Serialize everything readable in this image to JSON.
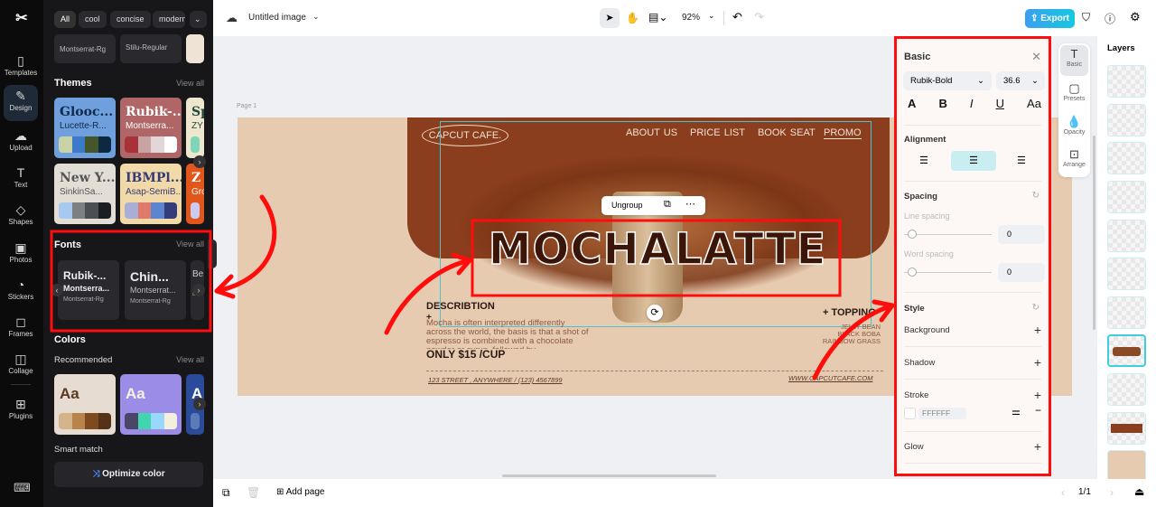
{
  "rail": {
    "items": [
      {
        "label": "Templates",
        "icon": "templates-icon"
      },
      {
        "label": "Design",
        "icon": "design-icon",
        "active": true
      },
      {
        "label": "Upload",
        "icon": "upload-icon"
      },
      {
        "label": "Text",
        "icon": "text-icon"
      },
      {
        "label": "Shapes",
        "icon": "shapes-icon"
      },
      {
        "label": "Photos",
        "icon": "photos-icon"
      },
      {
        "label": "Stickers",
        "icon": "stickers-icon"
      },
      {
        "label": "Frames",
        "icon": "frames-icon"
      },
      {
        "label": "Collage",
        "icon": "collage-icon"
      },
      {
        "label": "Plugins",
        "icon": "plugins-icon"
      }
    ]
  },
  "panel": {
    "chips": [
      "All",
      "cool",
      "concise",
      "modern"
    ],
    "top_cards": [
      {
        "sub": "Montserrat-Rg"
      },
      {
        "sub": "Stilu-Regular"
      }
    ],
    "themes": {
      "title": "Themes",
      "view_all": "View all",
      "cards": [
        {
          "t1": "Glooc...",
          "t2": "Lucette-R...",
          "bg": "#6f9fdc",
          "fg": "#0f2a4a",
          "sw": [
            "#c9d3a8",
            "#3b7bc9",
            "#45572a",
            "#0d2940"
          ]
        },
        {
          "t1": "Rubik-...",
          "t2": "Montserra...",
          "bg": "#b06666",
          "fg": "#fff",
          "sw": [
            "#a8323a",
            "#c9a3a3",
            "#e3d6d6",
            "#ffffff"
          ]
        },
        {
          "t1": "Sp",
          "t2": "ZY",
          "bg": "#efe6cf",
          "fg": "#1f4a3a",
          "sw": [
            "#80d6b8"
          ]
        },
        {
          "t1": "New Y...",
          "t2": "SinkinSa...",
          "bg": "#e2ddd5",
          "fg": "#555",
          "sw": [
            "#a7c9ef",
            "#7d8083",
            "#4b4e52",
            "#1c1e21"
          ]
        },
        {
          "t1": "IBMPl...",
          "t2": "Asap-SemiB...",
          "bg": "#f2d9a8",
          "fg": "#333a7a",
          "sw": [
            "#a9aed6",
            "#e07b6c",
            "#5c84cf",
            "#343c7a"
          ]
        },
        {
          "t1": "Z",
          "t2": "Gro",
          "bg": "#e2561c",
          "fg": "#fff",
          "sw": [
            "#c9cbf0"
          ]
        }
      ]
    },
    "fonts": {
      "title": "Fonts",
      "view_all": "View all",
      "cards": [
        {
          "t1": "Rubik-...",
          "t2": "Montserra...",
          "t3": "Montserrat-Rg"
        },
        {
          "t1": "Chin...",
          "t2": "Montserrat...",
          "t3": "Montserrat-Rg"
        },
        {
          "t1": "Be",
          "t2": "",
          "t3": "Bee"
        }
      ]
    },
    "colors": {
      "title": "Colors",
      "recommended": "Recommended",
      "view_all": "View all",
      "cards": [
        {
          "label": "Aa",
          "bg": "#e6dcd2",
          "fg": "#5a3a22",
          "sw": [
            "#d6b48a",
            "#b9844c",
            "#7e4a20",
            "#553218"
          ]
        },
        {
          "label": "Aa",
          "bg": "#9b8ce8",
          "fg": "#f5f0df",
          "sw": [
            "#4a4666",
            "#3fd6b0",
            "#9ad8fb",
            "#f3efdc"
          ]
        },
        {
          "label": "A",
          "bg": "#2a4a9a",
          "fg": "#fff",
          "sw": [
            "#5a7ab8"
          ]
        }
      ]
    },
    "smart_match": "Smart match",
    "optimize": "Optimize color"
  },
  "topbar": {
    "title": "Untitled image",
    "zoom": "92%",
    "export": "Export"
  },
  "canvas": {
    "page_label": "Page 1",
    "toolbar": {
      "ungroup": "Ungroup"
    }
  },
  "poster": {
    "logo": "CAPCUT CAFE.",
    "nav": [
      "ABOUT US",
      "PRICE LIST",
      "BOOK SEAT",
      "PROMO"
    ],
    "headline": "MOCHALATTE",
    "desc_title": "DESCRIBTION",
    "desc_plus": "+",
    "desc_text": "Mocha is often interpreted differently across the world, the basis is that a shot of espresso is combined with a chocolate powder or syrup, followed by",
    "price": "ONLY $15 /CUP",
    "topping_title": "+ TOPPING",
    "toppings": [
      "JELLY BEAN",
      "BLACK BOBA",
      "RAINBOW GRASS"
    ],
    "address": "123 STREET , ANYWHERE / (123) 4567899",
    "website": "WWW.CAPCUTCAFE.COM"
  },
  "props": {
    "title": "Basic",
    "font": "Rubik-Bold",
    "size": "36.6",
    "alignment": "Alignment",
    "spacing": "Spacing",
    "line_spacing": "Line spacing",
    "line_value": "0",
    "word_spacing": "Word spacing",
    "word_value": "0",
    "style": "Style",
    "background": "Background",
    "shadow": "Shadow",
    "stroke": "Stroke",
    "stroke_color": "FFFFFF",
    "glow": "Glow"
  },
  "tools": [
    {
      "label": "Basic"
    },
    {
      "label": "Presets"
    },
    {
      "label": "Opacity"
    },
    {
      "label": "Arrange"
    }
  ],
  "layers": {
    "title": "Layers"
  },
  "bottombar": {
    "add_page": "Add page",
    "page_indicator": "1/1"
  },
  "colors": {
    "accent": "#1fb6e6",
    "annotation": "#ff0d0d",
    "poster_brown": "#8a3e1e",
    "poster_bg": "#e7cbb0"
  }
}
